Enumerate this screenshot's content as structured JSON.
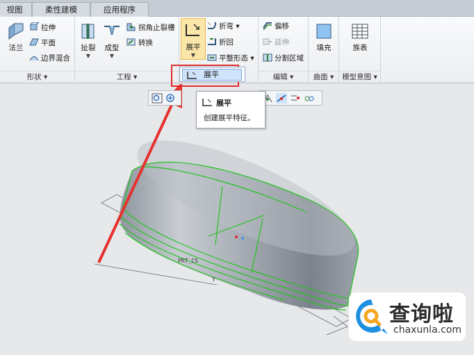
{
  "tabs": [
    "视图",
    "柔性建模",
    "应用程序"
  ],
  "groups": {
    "shape": {
      "label": "形状",
      "flange": "法兰",
      "extrude": "拉伸",
      "plane": "平面",
      "boundary_blend": "边界混合"
    },
    "engineering": {
      "label": "工程",
      "rip": "扯裂",
      "form": "成型",
      "corner_relief": "拐角止裂槽",
      "convert": "转换"
    },
    "bends": {
      "unbend": "展平",
      "bend": "折弯",
      "bend_back": "折回",
      "flat_pattern": "平整形态"
    },
    "editing": {
      "label": "编辑",
      "offset": "偏移",
      "extend": "延伸",
      "split_area": "分割区域"
    },
    "surfaces": {
      "label": "曲面",
      "fill": "填充"
    },
    "model_intent": {
      "label": "模型意图",
      "family_table": "族表"
    }
  },
  "dropdown": {
    "item": "展平"
  },
  "tooltip": {
    "title": "展平",
    "description": "创建展平特征。"
  },
  "model": {
    "part_label": "PRT_CS",
    "axis_label": "Y"
  },
  "watermark": {
    "text_cn": "查询啦",
    "text_en": "chaxunla.com"
  },
  "colors": {
    "highlight": "#e02a2a",
    "edge_green": "#22c41e",
    "watermark_blue": "#1f8fe0"
  }
}
